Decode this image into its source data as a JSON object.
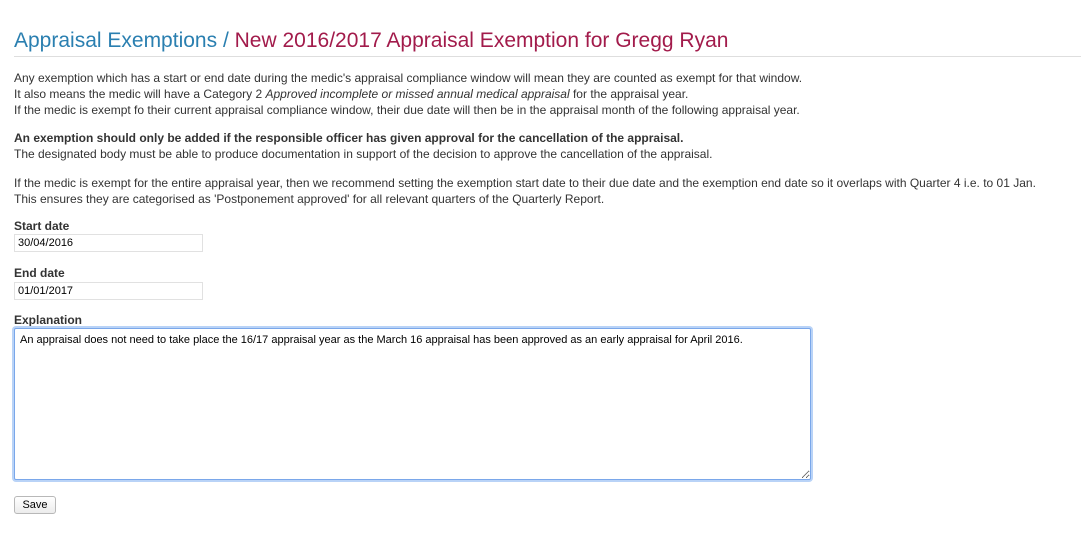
{
  "breadcrumb": {
    "parent": "Appraisal Exemptions",
    "separator": "/",
    "current": "New 2016/2017 Appraisal Exemption for Gregg Ryan"
  },
  "intro": {
    "line1": "Any exemption which has a start or end date during the medic's appraisal compliance window will mean they are counted as exempt for that window.",
    "line2_prefix": "It also means the medic will have a Category 2 ",
    "line2_italic": "Approved incomplete or missed annual medical appraisal",
    "line2_suffix": " for the appraisal year.",
    "line3": "If the medic is exempt fo their current appraisal compliance window, their due date will then be in the appraisal month of the following appraisal year."
  },
  "warning": {
    "bold": "An exemption should only be added if the responsible officer has given approval for the cancellation of the appraisal.",
    "line2": "The designated body must be able to produce documentation in support of the decision to approve the cancellation of the appraisal."
  },
  "recommendation": {
    "line1": "If the medic is exempt for the entire appraisal year, then we recommend setting the exemption start date to their due date and the exemption end date so it overlaps with Quarter 4 i.e. to 01 Jan.",
    "line2": "This ensures they are categorised as 'Postponement approved' for all relevant quarters of the Quarterly Report."
  },
  "form": {
    "start_label": "Start date",
    "start_value": "30/04/2016",
    "end_label": "End date",
    "end_value": "01/01/2017",
    "explanation_label": "Explanation",
    "explanation_value": "An appraisal does not need to take place the 16/17 appraisal year as the March 16 appraisal has been approved as an early appraisal for April 2016.",
    "save_label": "Save"
  },
  "colors": {
    "link": "#2a7fb0",
    "title": "#a21b4b",
    "focus": "#7aa7ea"
  }
}
